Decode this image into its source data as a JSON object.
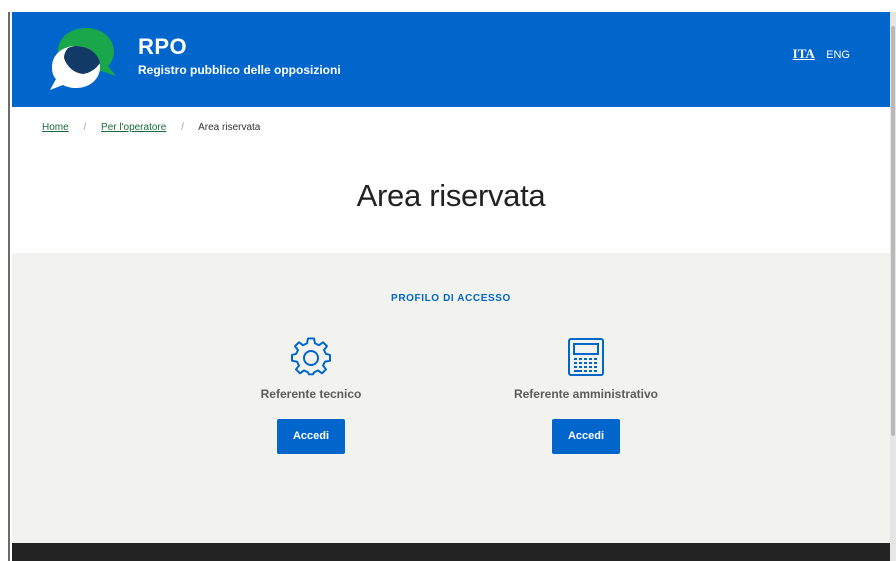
{
  "header": {
    "brand_title": "RPO",
    "brand_subtitle": "Registro pubblico delle opposizioni",
    "lang_active": "ITA",
    "lang_other": "ENG",
    "logo_icon": "speech-bubbles-logo-icon"
  },
  "breadcrumb": {
    "items": [
      "Home",
      "Per l'operatore",
      "Area riservata"
    ],
    "separator": "/"
  },
  "main": {
    "title": "Area riservata"
  },
  "access": {
    "heading": "PROFILO DI ACCESSO",
    "profiles": [
      {
        "label": "Referente tecnico",
        "icon": "gear-icon",
        "button_label": "Accedi"
      },
      {
        "label": "Referente amministrativo",
        "icon": "calculator-icon",
        "button_label": "Accedi"
      }
    ]
  },
  "colors": {
    "brand_blue": "#0066cc",
    "breadcrumb_link": "#1a6b3a",
    "section_bg": "#f2f2ee",
    "footer_bg": "#232323",
    "logo_green": "#1aa64a",
    "logo_navy": "#123a66"
  }
}
